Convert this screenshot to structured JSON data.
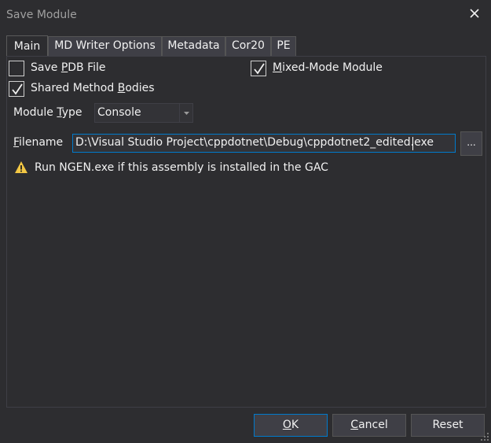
{
  "window": {
    "title": "Save Module"
  },
  "tabs": [
    {
      "label": "Main"
    },
    {
      "label": "MD Writer Options"
    },
    {
      "label": "Metadata"
    },
    {
      "label": "Cor20"
    },
    {
      "label": "PE"
    }
  ],
  "main": {
    "save_pdb": {
      "pre": "Save ",
      "accel": "P",
      "post": "DB File",
      "checked": false
    },
    "mixed_mode": {
      "pre": "",
      "accel": "M",
      "post": "ixed-Mode Module",
      "checked": true
    },
    "shared_method_bodies": {
      "pre": "Shared Method ",
      "accel": "B",
      "post": "odies",
      "checked": true
    },
    "module_type": {
      "pre": "Module ",
      "accel": "T",
      "post": "ype",
      "value": "Console"
    },
    "filename": {
      "pre": "",
      "accel": "F",
      "post": "ilename",
      "value": "D:\\Visual Studio Project\\cppdotnet\\Debug\\cppdotnet2_edited.exe"
    },
    "browse_label": "...",
    "warning": "Run NGEN.exe if this assembly is installed in the GAC"
  },
  "buttons": {
    "ok": {
      "pre": "",
      "accel": "O",
      "post": "K"
    },
    "cancel": {
      "pre": "",
      "accel": "C",
      "post": "ancel"
    },
    "reset": "Reset"
  },
  "colors": {
    "accent": "#007acc",
    "warning": "#f2c744",
    "background": "#2d2d30"
  }
}
